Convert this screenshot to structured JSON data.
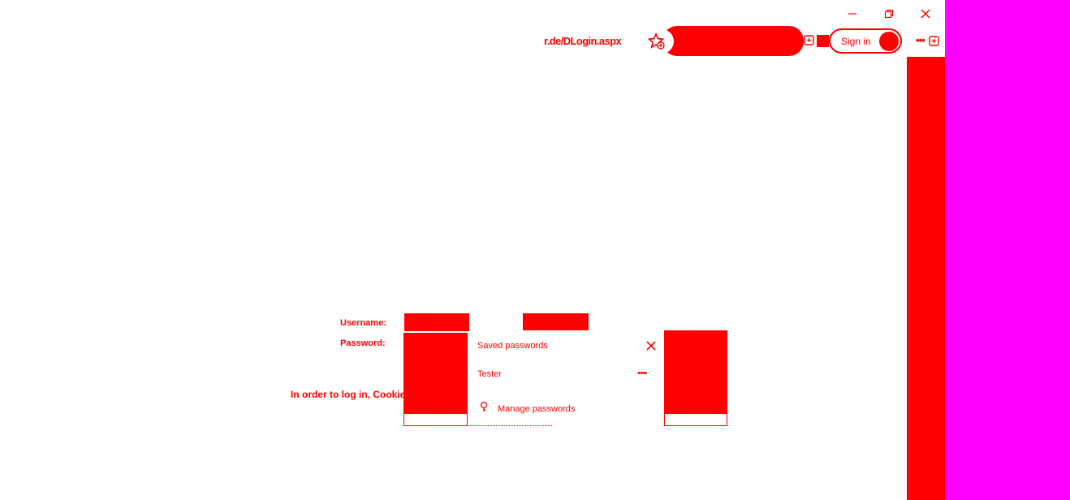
{
  "window_controls": {
    "minimize": "–",
    "maximize": "❐",
    "close": "✕"
  },
  "toolbar": {
    "address": "r.de/DLogin.aspx",
    "favorites_icon": "star-icon",
    "sign_in": "Sign in",
    "more": "•••"
  },
  "form": {
    "username_label": "Username:",
    "password_label": "Password:",
    "info_text": "In order to log in, Cookies"
  },
  "password_panel": {
    "title": "Saved passwords",
    "username": "Tester",
    "password_mask": "••••",
    "manage_label": "Manage passwords"
  },
  "colors": {
    "accent": "#ff0000",
    "side_area": "#ff00ff",
    "background": "#ffffff"
  }
}
